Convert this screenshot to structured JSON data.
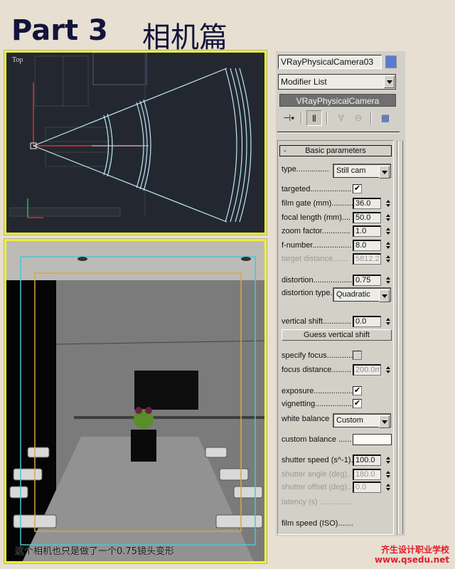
{
  "header": {
    "part": "Part 3",
    "title_cn": "相机篇"
  },
  "viewports": {
    "top": {
      "label": "Top"
    },
    "camera": {
      "caption": "这个相机也只是做了一个0.75镜头变形"
    }
  },
  "panel": {
    "object_name": "VRayPhysicalCamera03",
    "object_color": "#5a7bd1",
    "modifier_list": "Modifier List",
    "stack_item": "VRayPhysicalCamera",
    "stack_tools": [
      {
        "name": "pin-stack-icon",
        "glyph": "⊣▪"
      },
      {
        "name": "show-end-result-icon",
        "glyph": "Ⅱ"
      },
      {
        "name": "make-unique-icon",
        "glyph": "∀"
      },
      {
        "name": "remove-modifier-icon",
        "glyph": "⊖"
      },
      {
        "name": "configure-modifier-sets-icon",
        "glyph": "▦"
      }
    ],
    "rollout_title": "Basic parameters",
    "rollout_toggle": "-",
    "params": {
      "type": {
        "label": "type...............",
        "value": "Still cam"
      },
      "targeted": {
        "label": "targeted...................",
        "checked": true,
        "mark": "✔"
      },
      "film_gate": {
        "label": "film gate (mm)...........",
        "value": "36.0"
      },
      "focal_length": {
        "label": "focal length (mm)....",
        "value": "50.0"
      },
      "zoom_factor": {
        "label": "zoom factor.............",
        "value": "1.0"
      },
      "f_number": {
        "label": "f-number..................",
        "value": "8.0"
      },
      "target_distance": {
        "label": "target distance.......",
        "value": "5812.2"
      },
      "distortion": {
        "label": "distortion...................",
        "value": "0.75"
      },
      "distortion_type": {
        "label": "distortion type.",
        "value": "Quadratic"
      },
      "vertical_shift": {
        "label": "vertical shift.............",
        "value": "0.0"
      },
      "guess_vertical_shift": "Guess vertical shift",
      "specify_focus": {
        "label": "specify focus............",
        "checked": false,
        "mark": ""
      },
      "focus_distance": {
        "label": "focus distance.........",
        "value": "200.0m"
      },
      "exposure": {
        "label": "exposure...................",
        "checked": true,
        "mark": "✔"
      },
      "vignetting": {
        "label": "vignetting.................",
        "checked": true,
        "mark": "✔"
      },
      "white_balance": {
        "label": "white balance",
        "value": "Custom"
      },
      "custom_balance": {
        "label": "custom balance ......",
        "color": "#fdf9f4"
      },
      "shutter_speed": {
        "label": "shutter speed (s^-1).",
        "value": "100.0"
      },
      "shutter_angle": {
        "label": "shutter angle (deg)..",
        "value": "180.0"
      },
      "shutter_offset": {
        "label": "shutter offset (deg)..",
        "value": "0.0"
      },
      "latency": {
        "label": "latency (s) ..............."
      },
      "film_speed": {
        "label": "film speed (ISO)......."
      }
    }
  },
  "watermark": {
    "school": "齐生设计职业学校",
    "url": "www.qsedu.net"
  }
}
